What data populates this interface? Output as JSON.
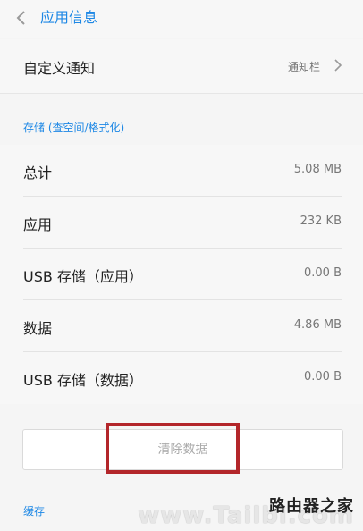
{
  "header": {
    "title": "应用信息"
  },
  "notify": {
    "label": "自定义通知",
    "value": "通知栏"
  },
  "storage": {
    "section_title": "存储 (查空间/格式化)",
    "rows": [
      {
        "label": "总计",
        "value": "5.08 MB"
      },
      {
        "label": "应用",
        "value": "232 KB"
      },
      {
        "label": "USB 存储（应用）",
        "value": "0.00 B"
      },
      {
        "label": "数据",
        "value": "4.86 MB"
      },
      {
        "label": "USB 存储（数据）",
        "value": "0.00 B"
      }
    ],
    "clear_button": "清除数据"
  },
  "cache": {
    "section_title": "缓存"
  },
  "watermark": {
    "line1": "路由器之家",
    "line2": "www.Tailbi.com"
  },
  "colors": {
    "accent": "#1e88e5",
    "highlight": "#b3262a"
  }
}
